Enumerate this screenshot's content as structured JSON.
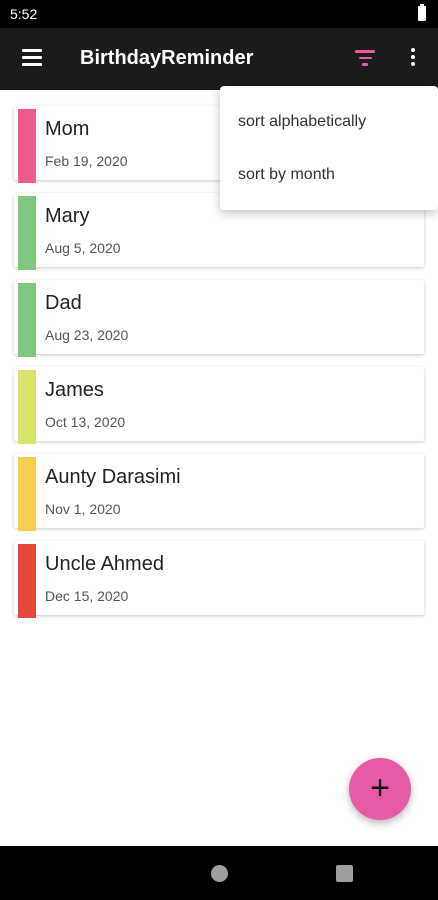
{
  "status_bar": {
    "time": "5:52"
  },
  "app_bar": {
    "title": "BirthdayReminder",
    "menu_icon": "hamburger-menu-icon",
    "filter_icon": "filter-icon",
    "filter_color": "#e75aa6",
    "more_icon": "more-vert-icon"
  },
  "birthdays": [
    {
      "name": "Mom",
      "date": "Feb 19, 2020",
      "color": "#ec5a8e"
    },
    {
      "name": "Mary",
      "date": "Aug 5, 2020",
      "color": "#7ec97e"
    },
    {
      "name": "Dad",
      "date": "Aug 23, 2020",
      "color": "#7ec97e"
    },
    {
      "name": "James",
      "date": "Oct 13, 2020",
      "color": "#d9e36a"
    },
    {
      "name": "Aunty Darasimi",
      "date": "Nov 1, 2020",
      "color": "#f7cf4e"
    },
    {
      "name": "Uncle Ahmed",
      "date": "Dec 15, 2020",
      "color": "#e24a3b"
    }
  ],
  "sort_menu": {
    "items": [
      {
        "label": "sort alphabetically"
      },
      {
        "label": "sort by month"
      }
    ]
  },
  "fab": {
    "symbol": "+",
    "icon": "add-icon",
    "color": "#e75aa6"
  },
  "nav_bar": {
    "home_icon": "home-circle-icon",
    "recents_icon": "recents-square-icon"
  }
}
